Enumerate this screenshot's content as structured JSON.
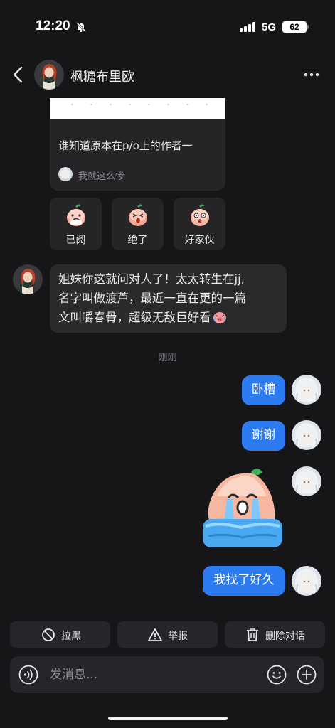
{
  "status_bar": {
    "time": "12:20",
    "network": "5G",
    "battery": "62"
  },
  "header": {
    "title": "枫糖布里欧"
  },
  "quote_card": {
    "text": "谁知道原本在p/o上的作者一",
    "author": "我就这么惨"
  },
  "reactions": [
    {
      "label": "已阅",
      "icon": "peach-read-emoji"
    },
    {
      "label": "绝了",
      "icon": "peach-wow-emoji"
    },
    {
      "label": "好家伙",
      "icon": "peach-shock-emoji"
    }
  ],
  "incoming": {
    "lines": [
      "姐妹你这就问对人了！太太转生在jj,",
      "名字叫做渡芦，最近一直在更的一篇",
      "文叫嚼春骨，超级无敌巨好看"
    ]
  },
  "timestamp": "刚刚",
  "outgoing": {
    "msg1": "卧槽",
    "msg2": "谢谢",
    "sticker": "crying-peach-sticker",
    "msg3": "我找了好久"
  },
  "actions": {
    "block": "拉黑",
    "report": "举报",
    "delete": "删除对话"
  },
  "input": {
    "placeholder": "发消息..."
  },
  "colors": {
    "accent": "#2d7bf0",
    "background": "#161618",
    "bubble": "#2a2a2d"
  }
}
